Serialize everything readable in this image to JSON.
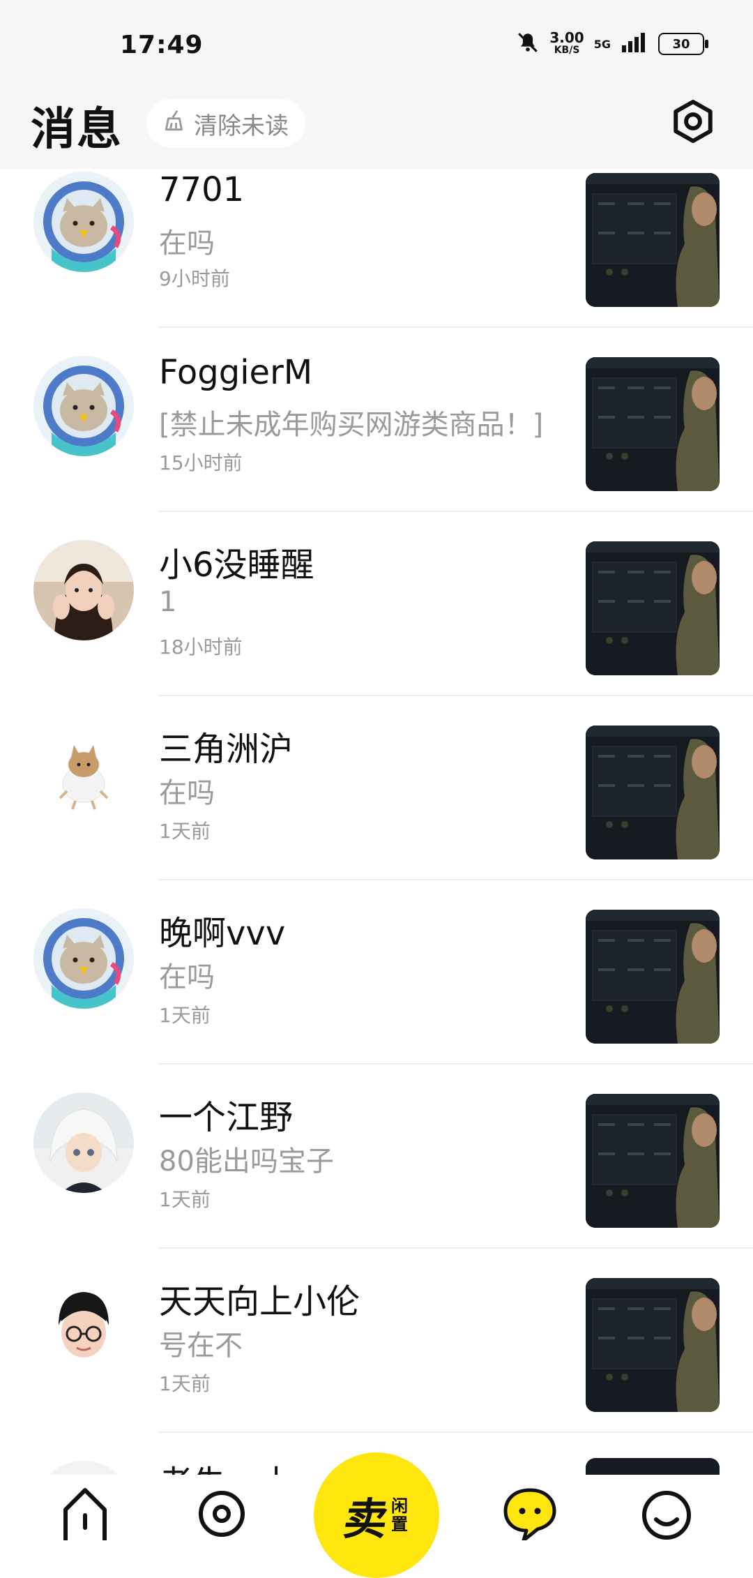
{
  "status_bar": {
    "time": "17:49",
    "net_speed_value": "3.00",
    "net_speed_unit": "KB/S",
    "network": "5G",
    "battery": "30"
  },
  "header": {
    "title": "消息",
    "clear_unread": "清除未读"
  },
  "conversations": [
    {
      "name": "7701",
      "message": "在吗",
      "time": "9小时前",
      "avatar": "cat-astronaut"
    },
    {
      "name": "FoggierM",
      "message": "[禁止未成年购买网游类商品！]",
      "time": "15小时前",
      "avatar": "cat-astronaut"
    },
    {
      "name": "小6没睡醒",
      "message": "1",
      "time": "18小时前",
      "avatar": "photo-girl"
    },
    {
      "name": "三角洲沪",
      "message": "在吗",
      "time": "1天前",
      "avatar": "photo-cat"
    },
    {
      "name": "晚啊vvv",
      "message": "在吗",
      "time": "1天前",
      "avatar": "cat-astronaut"
    },
    {
      "name": "一个江野",
      "message": "80能出吗宝子",
      "time": "1天前",
      "avatar": "photo-doll"
    },
    {
      "name": "天天向上小伦",
      "message": "号在不",
      "time": "1天前",
      "avatar": "memoji-boy"
    },
    {
      "name": "老朱一十一",
      "message": "",
      "time": "",
      "avatar": "partial"
    }
  ],
  "bottom_nav": {
    "sell_main": "卖",
    "sell_sub_1": "闲",
    "sell_sub_2": "置"
  },
  "colors": {
    "accent_yellow": "#ffe60f",
    "background_gray": "#f6f6f6"
  }
}
